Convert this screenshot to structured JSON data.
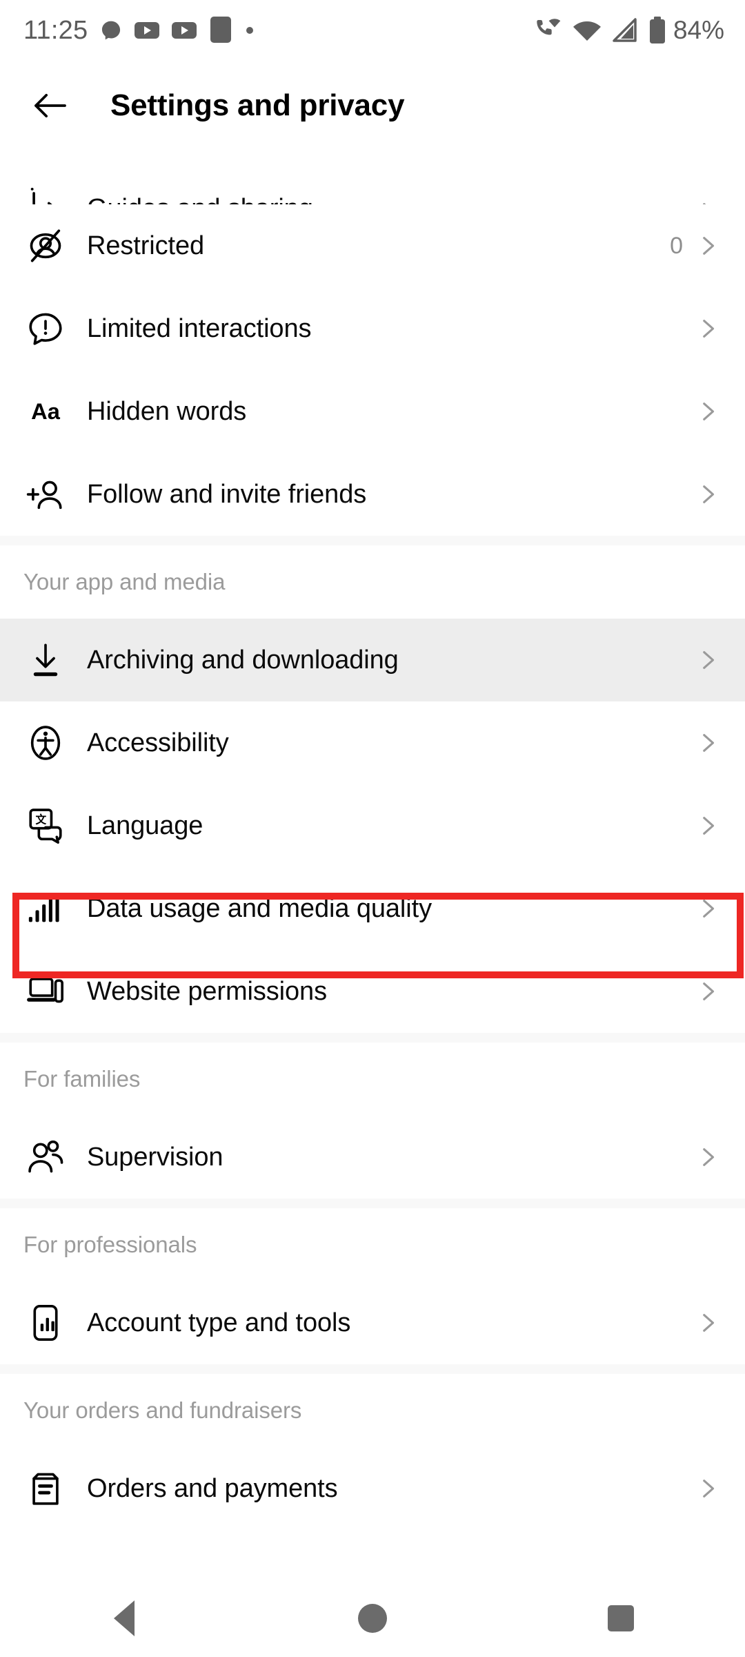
{
  "status_bar": {
    "time": "11:25",
    "battery_text": "84%",
    "left_icons": [
      "messenger-icon",
      "youtube-icon",
      "youtube-icon",
      "app-square-icon",
      "dot-icon"
    ],
    "right_icons": [
      "phone-wifi-calling-icon",
      "wifi-icon",
      "cellular-signal-icon",
      "battery-icon"
    ]
  },
  "header": {
    "back_icon": "arrow-left-icon",
    "title": "Settings and privacy"
  },
  "colors": {
    "annotation_red": "#EE2724",
    "row_highlight": "#EDEDED",
    "divider": "#F8F8F8",
    "muted_text": "#9B9B9B",
    "chevron": "#9A9A9A"
  },
  "sections": [
    {
      "id": "clipped-top",
      "header": null,
      "items": [
        {
          "label": "Guides and sharing",
          "icon": "share-arrow-icon",
          "value": null,
          "clipped": true,
          "highlighted": false,
          "annotated": false
        }
      ]
    },
    {
      "id": "who-can-see",
      "header": null,
      "items": [
        {
          "label": "Restricted",
          "icon": "restricted-user-slash-icon",
          "value": "0",
          "clipped": false,
          "highlighted": false,
          "annotated": false
        },
        {
          "label": "Limited interactions",
          "icon": "comment-exclamation-icon",
          "value": null,
          "clipped": false,
          "highlighted": false,
          "annotated": false
        },
        {
          "label": "Hidden words",
          "icon": "aa-text-icon",
          "value": null,
          "clipped": false,
          "highlighted": false,
          "annotated": false
        },
        {
          "label": "Follow and invite friends",
          "icon": "add-person-icon",
          "value": null,
          "clipped": false,
          "highlighted": false,
          "annotated": false
        }
      ]
    },
    {
      "id": "your-app-and-media",
      "header": "Your app and media",
      "items": [
        {
          "label": "Archiving and downloading",
          "icon": "download-icon",
          "value": null,
          "clipped": false,
          "highlighted": true,
          "annotated": false
        },
        {
          "label": "Accessibility",
          "icon": "accessibility-icon",
          "value": null,
          "clipped": false,
          "highlighted": false,
          "annotated": false
        },
        {
          "label": "Language",
          "icon": "language-translate-icon",
          "value": null,
          "clipped": false,
          "highlighted": false,
          "annotated": false
        },
        {
          "label": "Data usage and media quality",
          "icon": "signal-bars-icon",
          "value": null,
          "clipped": false,
          "highlighted": false,
          "annotated": true
        },
        {
          "label": "Website permissions",
          "icon": "browser-device-icon",
          "value": null,
          "clipped": false,
          "highlighted": false,
          "annotated": false
        }
      ]
    },
    {
      "id": "for-families",
      "header": "For families",
      "items": [
        {
          "label": "Supervision",
          "icon": "two-people-icon",
          "value": null,
          "clipped": false,
          "highlighted": false,
          "annotated": false
        }
      ]
    },
    {
      "id": "for-professionals",
      "header": "For professionals",
      "items": [
        {
          "label": "Account type and tools",
          "icon": "phone-chart-icon",
          "value": null,
          "clipped": false,
          "highlighted": false,
          "annotated": false
        }
      ]
    },
    {
      "id": "your-orders-and-fundraisers",
      "header": "Your orders and fundraisers",
      "items": [
        {
          "label": "Orders and payments",
          "icon": "receipt-icon",
          "value": null,
          "clipped": false,
          "highlighted": false,
          "annotated": false
        }
      ]
    }
  ],
  "nav_bar": {
    "back": "nav-back-triangle-icon",
    "home": "nav-home-circle-icon",
    "recents": "nav-recents-square-icon"
  }
}
